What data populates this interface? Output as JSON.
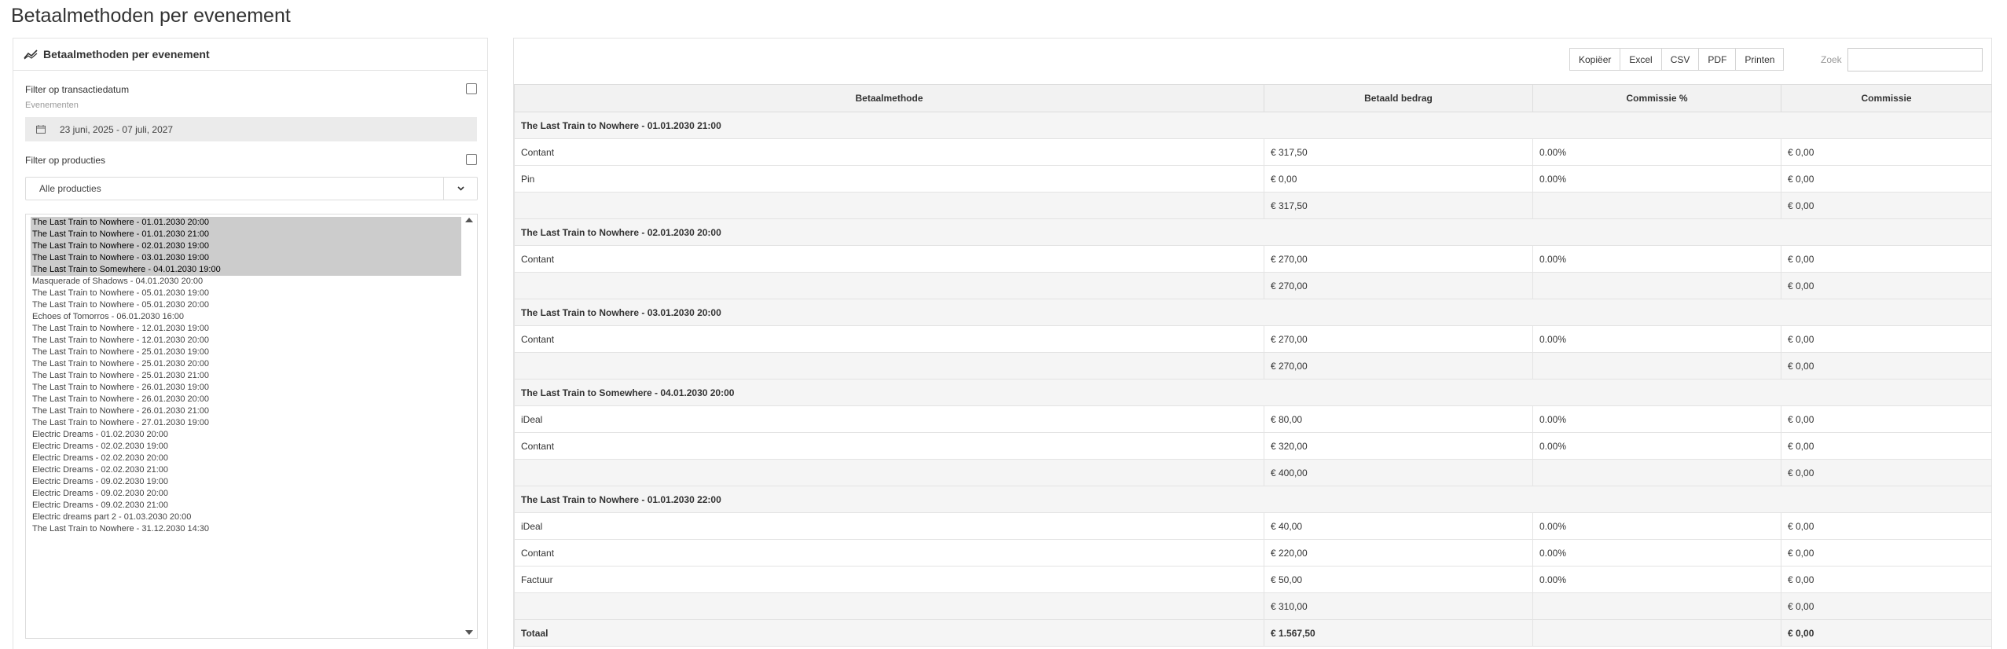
{
  "page": {
    "title": "Betaalmethoden per evenement"
  },
  "left": {
    "header": "Betaalmethoden per evenement",
    "filter_date_label": "Filter op transactiedatum",
    "events_label": "Evenementen",
    "date_range": "23 juni, 2025 - 07 juli, 2027",
    "filter_products_label": "Filter op producties",
    "products_select": "Alle producties",
    "events": [
      {
        "label": "The Last Train to Nowhere - 01.01.2030 20:00",
        "selected": true
      },
      {
        "label": "The Last Train to Nowhere - 01.01.2030 21:00",
        "selected": true
      },
      {
        "label": "The Last Train to Nowhere - 02.01.2030 19:00",
        "selected": true
      },
      {
        "label": "The Last Train to Nowhere - 03.01.2030 19:00",
        "selected": true
      },
      {
        "label": "The Last Train to Somewhere - 04.01.2030 19:00",
        "selected": true
      },
      {
        "label": "Masquerade of Shadows - 04.01.2030 20:00",
        "selected": false
      },
      {
        "label": "The Last Train to Nowhere - 05.01.2030 19:00",
        "selected": false
      },
      {
        "label": "The Last Train to Nowhere - 05.01.2030 20:00",
        "selected": false
      },
      {
        "label": "Echoes of Tomorros - 06.01.2030 16:00",
        "selected": false
      },
      {
        "label": "The Last Train to Nowhere - 12.01.2030 19:00",
        "selected": false
      },
      {
        "label": "The Last Train to Nowhere - 12.01.2030 20:00",
        "selected": false
      },
      {
        "label": "The Last Train to Nowhere - 25.01.2030 19:00",
        "selected": false
      },
      {
        "label": "The Last Train to Nowhere - 25.01.2030 20:00",
        "selected": false
      },
      {
        "label": "The Last Train to Nowhere - 25.01.2030 21:00",
        "selected": false
      },
      {
        "label": "The Last Train to Nowhere - 26.01.2030 19:00",
        "selected": false
      },
      {
        "label": "The Last Train to Nowhere - 26.01.2030 20:00",
        "selected": false
      },
      {
        "label": "The Last Train to Nowhere - 26.01.2030 21:00",
        "selected": false
      },
      {
        "label": "The Last Train to Nowhere - 27.01.2030 19:00",
        "selected": false
      },
      {
        "label": "Electric Dreams - 01.02.2030 20:00",
        "selected": false
      },
      {
        "label": "Electric Dreams - 02.02.2030 19:00",
        "selected": false
      },
      {
        "label": "Electric Dreams - 02.02.2030 20:00",
        "selected": false
      },
      {
        "label": "Electric Dreams - 02.02.2030 21:00",
        "selected": false
      },
      {
        "label": "Electric Dreams - 09.02.2030 19:00",
        "selected": false
      },
      {
        "label": "Electric Dreams - 09.02.2030 20:00",
        "selected": false
      },
      {
        "label": "Electric Dreams - 09.02.2030 21:00",
        "selected": false
      },
      {
        "label": "Electric dreams part 2 - 01.03.2030 20:00",
        "selected": false
      },
      {
        "label": "The Last Train to Nowhere - 31.12.2030 14:30",
        "selected": false
      }
    ]
  },
  "right": {
    "buttons": [
      "Kopiëer",
      "Excel",
      "CSV",
      "PDF",
      "Printen"
    ],
    "search_label": "Zoek",
    "columns": [
      "Betaalmethode",
      "Betaald bedrag",
      "Commissie %",
      "Commissie"
    ],
    "rows": [
      {
        "type": "group",
        "cells": [
          "The Last Train to Nowhere - 01.01.2030 21:00"
        ]
      },
      {
        "type": "data",
        "cells": [
          "Contant",
          "€ 317,50",
          "0.00%",
          "€ 0,00"
        ]
      },
      {
        "type": "data",
        "cells": [
          "Pin",
          "€ 0,00",
          "0.00%",
          "€ 0,00"
        ]
      },
      {
        "type": "sub",
        "cells": [
          "",
          "€ 317,50",
          "",
          "€ 0,00"
        ]
      },
      {
        "type": "group",
        "cells": [
          "The Last Train to Nowhere - 02.01.2030 20:00"
        ]
      },
      {
        "type": "data",
        "cells": [
          "Contant",
          "€ 270,00",
          "0.00%",
          "€ 0,00"
        ]
      },
      {
        "type": "sub",
        "cells": [
          "",
          "€ 270,00",
          "",
          "€ 0,00"
        ]
      },
      {
        "type": "group",
        "cells": [
          "The Last Train to Nowhere - 03.01.2030 20:00"
        ]
      },
      {
        "type": "data",
        "cells": [
          "Contant",
          "€ 270,00",
          "0.00%",
          "€ 0,00"
        ]
      },
      {
        "type": "sub",
        "cells": [
          "",
          "€ 270,00",
          "",
          "€ 0,00"
        ]
      },
      {
        "type": "group",
        "cells": [
          "The Last Train to Somewhere - 04.01.2030 20:00"
        ]
      },
      {
        "type": "data",
        "cells": [
          "iDeal",
          "€ 80,00",
          "0.00%",
          "€ 0,00"
        ]
      },
      {
        "type": "data",
        "cells": [
          "Contant",
          "€ 320,00",
          "0.00%",
          "€ 0,00"
        ]
      },
      {
        "type": "sub",
        "cells": [
          "",
          "€ 400,00",
          "",
          "€ 0,00"
        ]
      },
      {
        "type": "group",
        "cells": [
          "The Last Train to Nowhere - 01.01.2030 22:00"
        ]
      },
      {
        "type": "data",
        "cells": [
          "iDeal",
          "€ 40,00",
          "0.00%",
          "€ 0,00"
        ]
      },
      {
        "type": "data",
        "cells": [
          "Contant",
          "€ 220,00",
          "0.00%",
          "€ 0,00"
        ]
      },
      {
        "type": "data",
        "cells": [
          "Factuur",
          "€ 50,00",
          "0.00%",
          "€ 0,00"
        ]
      },
      {
        "type": "sub",
        "cells": [
          "",
          "€ 310,00",
          "",
          "€ 0,00"
        ]
      },
      {
        "type": "total",
        "cells": [
          "Totaal",
          "€ 1.567,50",
          "",
          "€ 0,00"
        ]
      }
    ]
  }
}
